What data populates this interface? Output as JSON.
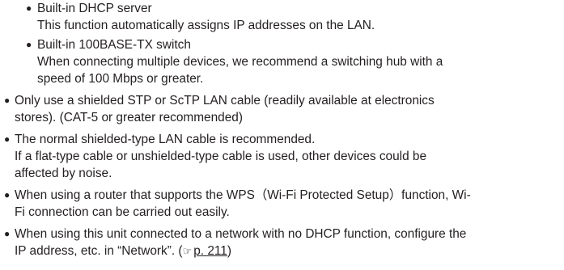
{
  "sub_items": [
    {
      "title": "Built-in DHCP server",
      "lines": [
        "This function automatically assigns IP addresses on the LAN."
      ]
    },
    {
      "title": "Built-in 100BASE-TX switch",
      "lines": [
        "When connecting multiple devices, we recommend a switching hub with a",
        "speed of 100 Mbps or greater."
      ]
    }
  ],
  "items": [
    {
      "lines": [
        "Only use a shielded STP or ScTP LAN cable (readily available at electronics",
        "stores). (CAT-5 or greater recommended)"
      ]
    },
    {
      "lines": [
        "The normal shielded-type LAN cable is recommended.",
        "If a flat-type cable or unshielded-type cable is used, other devices could be",
        "affected by noise."
      ]
    },
    {
      "lines": [
        "When using a router that supports the WPS（Wi-Fi Protected Setup）function, Wi-",
        "Fi connection can be carried out easily."
      ]
    },
    {
      "lines": [
        "When using this unit connected to a network with no DHCP function, configure the",
        "IP address, etc. in “Network”. ("
      ],
      "reference": {
        "icon": "reference-hand-icon",
        "text": "p. 211"
      },
      "after_reference": ")"
    }
  ]
}
